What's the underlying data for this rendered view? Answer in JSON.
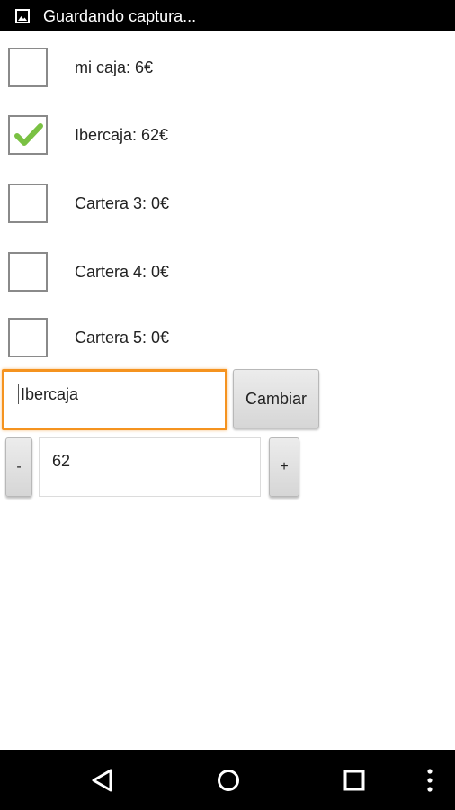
{
  "status_bar": {
    "icon": "image-icon",
    "text": "Guardando captura..."
  },
  "wallets": [
    {
      "label": "mi caja: 6€",
      "checked": false
    },
    {
      "label": "Ibercaja: 62€",
      "checked": true
    },
    {
      "label": "Cartera 3: 0€",
      "checked": false
    },
    {
      "label": "Cartera 4: 0€",
      "checked": false
    },
    {
      "label": "Cartera 5: 0€",
      "checked": false
    }
  ],
  "name_editor": {
    "value": "Ibercaja",
    "change_button_label": "Cambiar"
  },
  "amount_editor": {
    "minus_label": "-",
    "value": "62",
    "plus_label": "+"
  },
  "nav_bar": {
    "icons": [
      "back-icon",
      "home-icon",
      "recents-icon",
      "overflow-menu-icon"
    ]
  },
  "colors": {
    "status_bar_bg": "#000000",
    "focus_accent": "#f5931f",
    "check_green": "#7ac143"
  }
}
